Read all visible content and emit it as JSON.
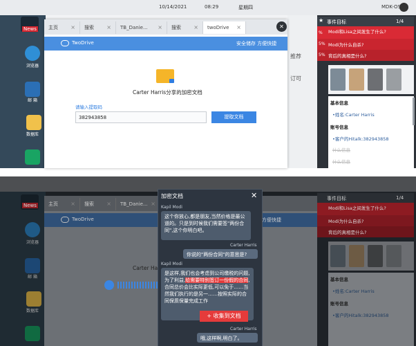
{
  "top": {
    "date": "10/14/2021",
    "time": "08:29",
    "weekday": "星期四",
    "device": "MDK-OS"
  },
  "desktop": {
    "icons": [
      {
        "label": "News"
      },
      {
        "label": "浏览器"
      },
      {
        "label": "邮 箱"
      },
      {
        "label": "数据库"
      }
    ]
  },
  "browser": {
    "tabs": [
      {
        "label": "主页"
      },
      {
        "label": "搜索"
      },
      {
        "label": "TB_Danie..."
      },
      {
        "label": "搜索"
      },
      {
        "label": "twoDrive"
      }
    ],
    "tab_close": "×",
    "close_glyph": "✕",
    "drive_name": "TwoDrive",
    "drive_tagline": "安全储存 方便快捷",
    "bg_text_1": "推荐",
    "bg_text_2": "订可",
    "folder_title": "Carter Harris分享的加密文档",
    "code_label": "请输入提取码",
    "code_value": "382943858",
    "extract_button": "提取文档"
  },
  "right": {
    "title": "事件目标",
    "count": "1/4",
    "events": [
      "Modi和Lisa之间发生了什么?",
      "Modi为什么自杀?",
      "背后的真相是什么?"
    ],
    "percents": [
      "%",
      "5%",
      "5%"
    ],
    "basic_info_title": "基本信息",
    "name_item": "•姓名:Carter Harris",
    "account_title": "账号信息",
    "account_item": "•客户的Hitalk:382943858",
    "strike_1": "什么信息",
    "strike_2": "什么信息"
  },
  "bottom": {
    "browser_tabs": [
      {
        "label": "主页"
      },
      {
        "label": "搜索"
      },
      {
        "label": "TB_Danie..."
      }
    ],
    "drive_name": "TwoDrive",
    "drive_tagline": "方便快捷",
    "folder_title_partial": "Carter Harr",
    "doc_title": "加密文档",
    "close_glyph": "✕",
    "messages": [
      {
        "speaker": "Kapil Modi",
        "side": "left",
        "text": "这个你放心,都是朋友,当然价格是最公道的。只是到时候我们需要签\"两份合同\",这个你明白吧。"
      },
      {
        "speaker": "Carter Harris",
        "side": "right",
        "text": "你说的\"两份合同\"的意思是?"
      },
      {
        "speaker": "Kapil Modi",
        "side": "left",
        "text_before": "是这样,我们也会考虑到公司缴税的问题,为了利益,",
        "text_highlight": "给需要特别签订一份假的合同",
        "text_after": ",合同总价会比实际更低,可以免于……当然我们执行的是另一……按照实际的合同保质保量完成工作"
      },
      {
        "speaker": "Carter Harris",
        "side": "right",
        "text": "哦,这样啊,明白了。"
      }
    ],
    "collect_button": "+ 收集到文档",
    "right_title": "事件目标",
    "right_count": "1/4",
    "events": [
      "Modi和Lisa之间发生了什么?",
      "Modi为什么自杀?",
      "背后的真相是什么?"
    ],
    "basic_info_title": "基本信息",
    "name_item": "•姓名:Carter Harris",
    "account_title": "账号信息",
    "account_item": "•客户的Hitalk:382943858"
  }
}
